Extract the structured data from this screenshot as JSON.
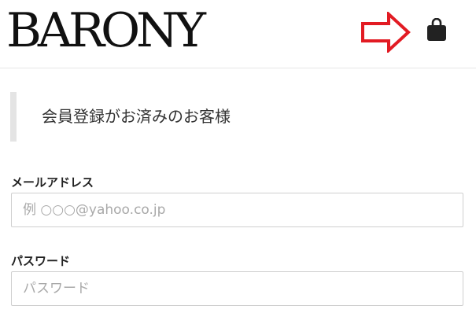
{
  "header": {
    "logo_text": "BARONY",
    "icons": {
      "arrow": "arrow-right-icon",
      "cart": "shopping-bag-icon",
      "arrow_color": "#e21b23"
    }
  },
  "login": {
    "section_title": "会員登録がお済みのお客様",
    "email": {
      "label": "メールアドレス",
      "placeholder": "例 ○○○@yahoo.co.jp",
      "value": ""
    },
    "password": {
      "label": "パスワード",
      "placeholder": "パスワード",
      "value": ""
    }
  }
}
